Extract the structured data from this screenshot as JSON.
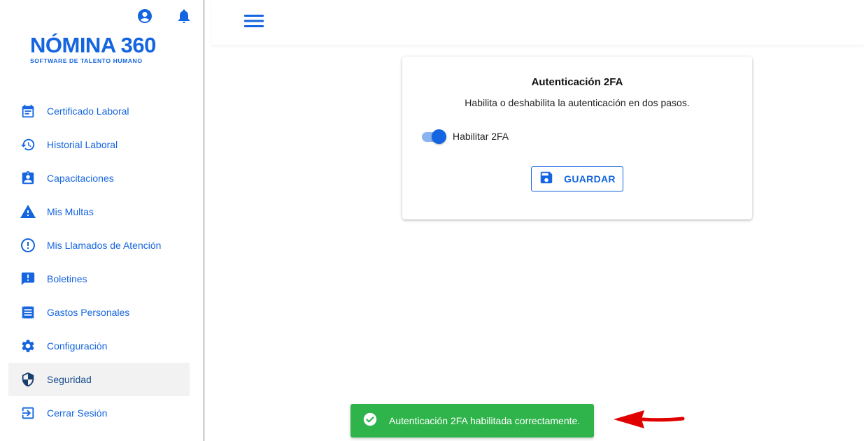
{
  "sidebar": {
    "logo": {
      "main": "NÓMINA 360",
      "sub": "SOFTWARE DE TALENTO HUMANO"
    },
    "top_icons": [
      "account-circle-icon",
      "bell-icon"
    ],
    "items": [
      {
        "label": "Certificado Laboral",
        "icon": "calendar-icon",
        "active": false
      },
      {
        "label": "Historial Laboral",
        "icon": "history-icon",
        "active": false
      },
      {
        "label": "Capacitaciones",
        "icon": "clipboard-account-icon",
        "active": false
      },
      {
        "label": "Mis Multas",
        "icon": "warning-icon",
        "active": false
      },
      {
        "label": "Mis Llamados de Atención",
        "icon": "alert-circle-icon",
        "active": false
      },
      {
        "label": "Boletines",
        "icon": "announcement-icon",
        "active": false
      },
      {
        "label": "Gastos Personales",
        "icon": "receipt-icon",
        "active": false
      },
      {
        "label": "Configuración",
        "icon": "gear-icon",
        "active": false
      },
      {
        "label": "Seguridad",
        "icon": "shield-icon",
        "active": true
      },
      {
        "label": "Cerrar Sesión",
        "icon": "logout-icon",
        "active": false
      }
    ]
  },
  "appbar": {
    "menu_icon": "hamburger-menu-icon"
  },
  "card": {
    "title": "Autenticación 2FA",
    "description": "Habilita o deshabilita la autenticación en dos pasos.",
    "toggle_label": "Habilitar 2FA",
    "toggle_on": true,
    "save_label": "GUARDAR"
  },
  "toast": {
    "message": "Autenticación 2FA habilitada correctamente."
  },
  "colors": {
    "primary": "#1565e0",
    "success": "#2fb34b",
    "arrow": "#e00000"
  }
}
